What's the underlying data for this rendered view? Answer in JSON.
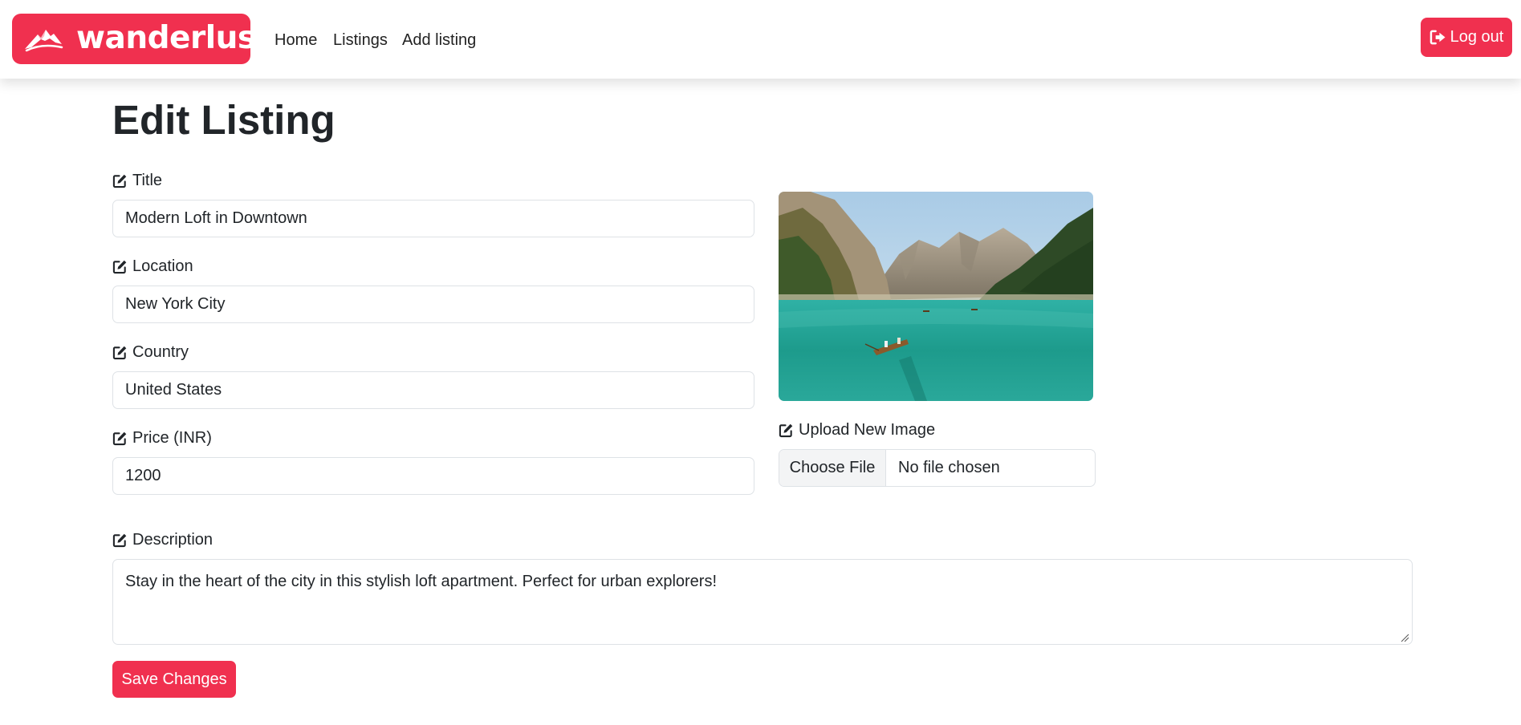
{
  "brand": {
    "name": "wanderlust",
    "color": "#f0304f",
    "logo_icon": "mountain-logo-icon"
  },
  "nav": {
    "links": [
      {
        "label": "Home"
      },
      {
        "label": "Listings"
      },
      {
        "label": "Add listing"
      }
    ],
    "logout": {
      "label": "Log out",
      "icon": "sign-out-icon"
    }
  },
  "page": {
    "title": "Edit Listing"
  },
  "form": {
    "title": {
      "label": "Title",
      "value": "Modern Loft in Downtown"
    },
    "location": {
      "label": "Location",
      "value": "New York City"
    },
    "country": {
      "label": "Country",
      "value": "United States"
    },
    "price": {
      "label": "Price (INR)",
      "value": "1200"
    },
    "description": {
      "label": "Description",
      "value": "Stay in the heart of the city in this stylish loft apartment. Perfect for urban explorers!"
    },
    "image_upload": {
      "label": "Upload New Image",
      "button_label": "Choose File",
      "status": "No file chosen"
    },
    "label_icon": "edit-icon",
    "save_label": "Save Changes"
  }
}
